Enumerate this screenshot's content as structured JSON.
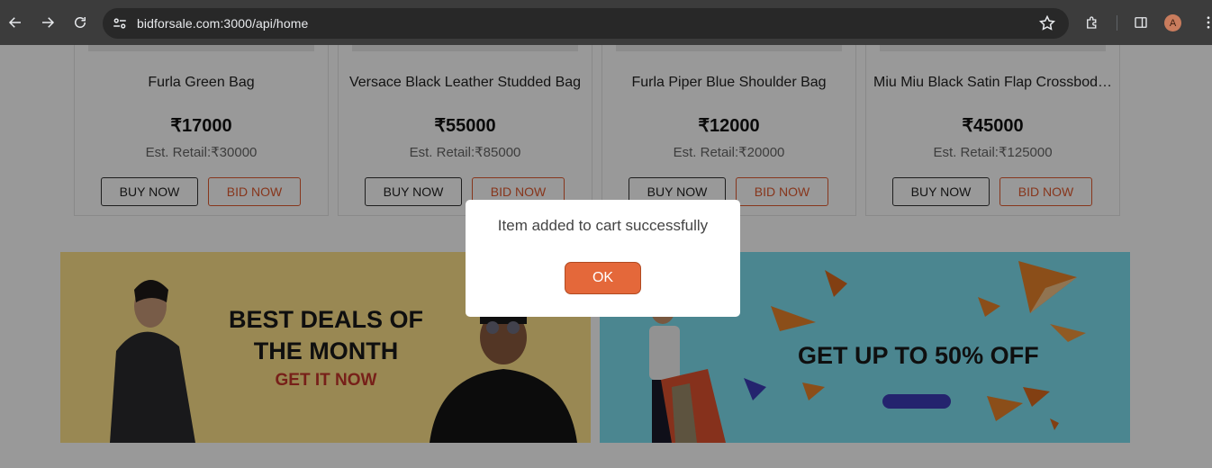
{
  "browser": {
    "url": "bidforsale.com:3000/api/home",
    "profile_initial": "A"
  },
  "products": [
    {
      "name": "Furla Green Bag",
      "price": "₹17000",
      "retail": "Est. Retail:₹30000",
      "buy_label": "BUY NOW",
      "bid_label": "BID NOW"
    },
    {
      "name": "Versace Black Leather Studded Bag",
      "price": "₹55000",
      "retail": "Est. Retail:₹85000",
      "buy_label": "BUY NOW",
      "bid_label": "BID NOW"
    },
    {
      "name": "Furla Piper Blue Shoulder Bag",
      "price": "₹12000",
      "retail": "Est. Retail:₹20000",
      "buy_label": "BUY NOW",
      "bid_label": "BID NOW"
    },
    {
      "name": "Miu Miu Black Satin Flap Crossbody Bag",
      "price": "₹45000",
      "retail": "Est. Retail:₹125000",
      "buy_label": "BUY NOW",
      "bid_label": "BID NOW"
    }
  ],
  "banners": {
    "left_title": "BEST DEALS OF THE MONTH",
    "left_sub": "GET IT NOW",
    "right_title": "GET UP TO 50% OFF"
  },
  "modal": {
    "message": "Item added to cart successfully",
    "ok_label": "OK"
  },
  "colors": {
    "accent": "#e4683a",
    "bid_border": "#e15a2f",
    "banner_left_bg": "#ffe38a",
    "banner_right_bg": "#7ee0f0"
  }
}
